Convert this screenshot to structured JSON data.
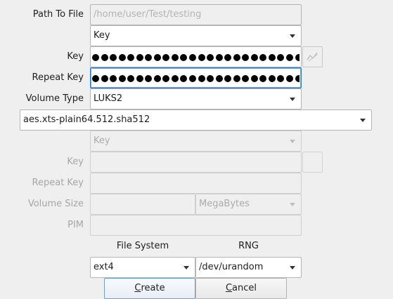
{
  "form": {
    "path_label": "Path To File",
    "path_value": "/home/user/Test/testing",
    "key_type": "Key",
    "key_label": "Key",
    "repeat_key_label": "Repeat Key",
    "volume_type_label": "Volume Type",
    "volume_type": "LUKS2",
    "cipher": "aes.xts-plain64.512.sha512"
  },
  "secondary": {
    "key_type": "Key",
    "key_label": "Key",
    "repeat_key_label": "Repeat Key",
    "volume_size_label": "Volume Size",
    "volume_size_unit": "MegaBytes",
    "pim_label": "PIM"
  },
  "options": {
    "file_system_label": "File System",
    "file_system": "ext4",
    "rng_label": "RNG",
    "rng": "/dev/urandom"
  },
  "buttons": {
    "create_c": "C",
    "create_rest": "reate",
    "cancel_c": "C",
    "cancel_rest": "ancel"
  },
  "icons": {
    "key_reveal": "eye-slash-icon"
  }
}
